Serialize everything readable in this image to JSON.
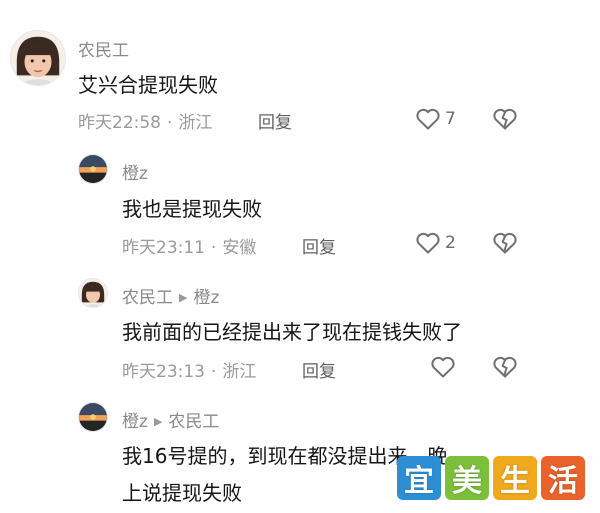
{
  "comments": [
    {
      "user": "农民工",
      "reply_to": "",
      "text": "艾兴合提现失败",
      "time": "昨天22:58",
      "location": "浙江",
      "reply_label": "回复",
      "likes": "7"
    },
    {
      "user": "橙z",
      "reply_to": "",
      "text": "我也是提现失败",
      "time": "昨天23:11",
      "location": "安徽",
      "reply_label": "回复",
      "likes": "2"
    },
    {
      "user": "农民工",
      "reply_to": "橙z",
      "text": "我前面的已经提出来了现在提钱失败了",
      "time": "昨天23:13",
      "location": "浙江",
      "reply_label": "回复",
      "likes": ""
    },
    {
      "user": "橙z",
      "reply_to": "农民工",
      "text_line1": "我16号提的，到现在都没提出来，晚",
      "text_line2": "上说提现失败"
    }
  ],
  "separator": "·",
  "watermark": {
    "chars": [
      "宜",
      "美",
      "生",
      "活"
    ],
    "colors": [
      "#2c8fd6",
      "#7bbf3a",
      "#f0a81c",
      "#e9622b"
    ]
  },
  "icons": [
    "heart-outline-icon",
    "broken-heart-icon",
    "reply-arrow-icon"
  ]
}
